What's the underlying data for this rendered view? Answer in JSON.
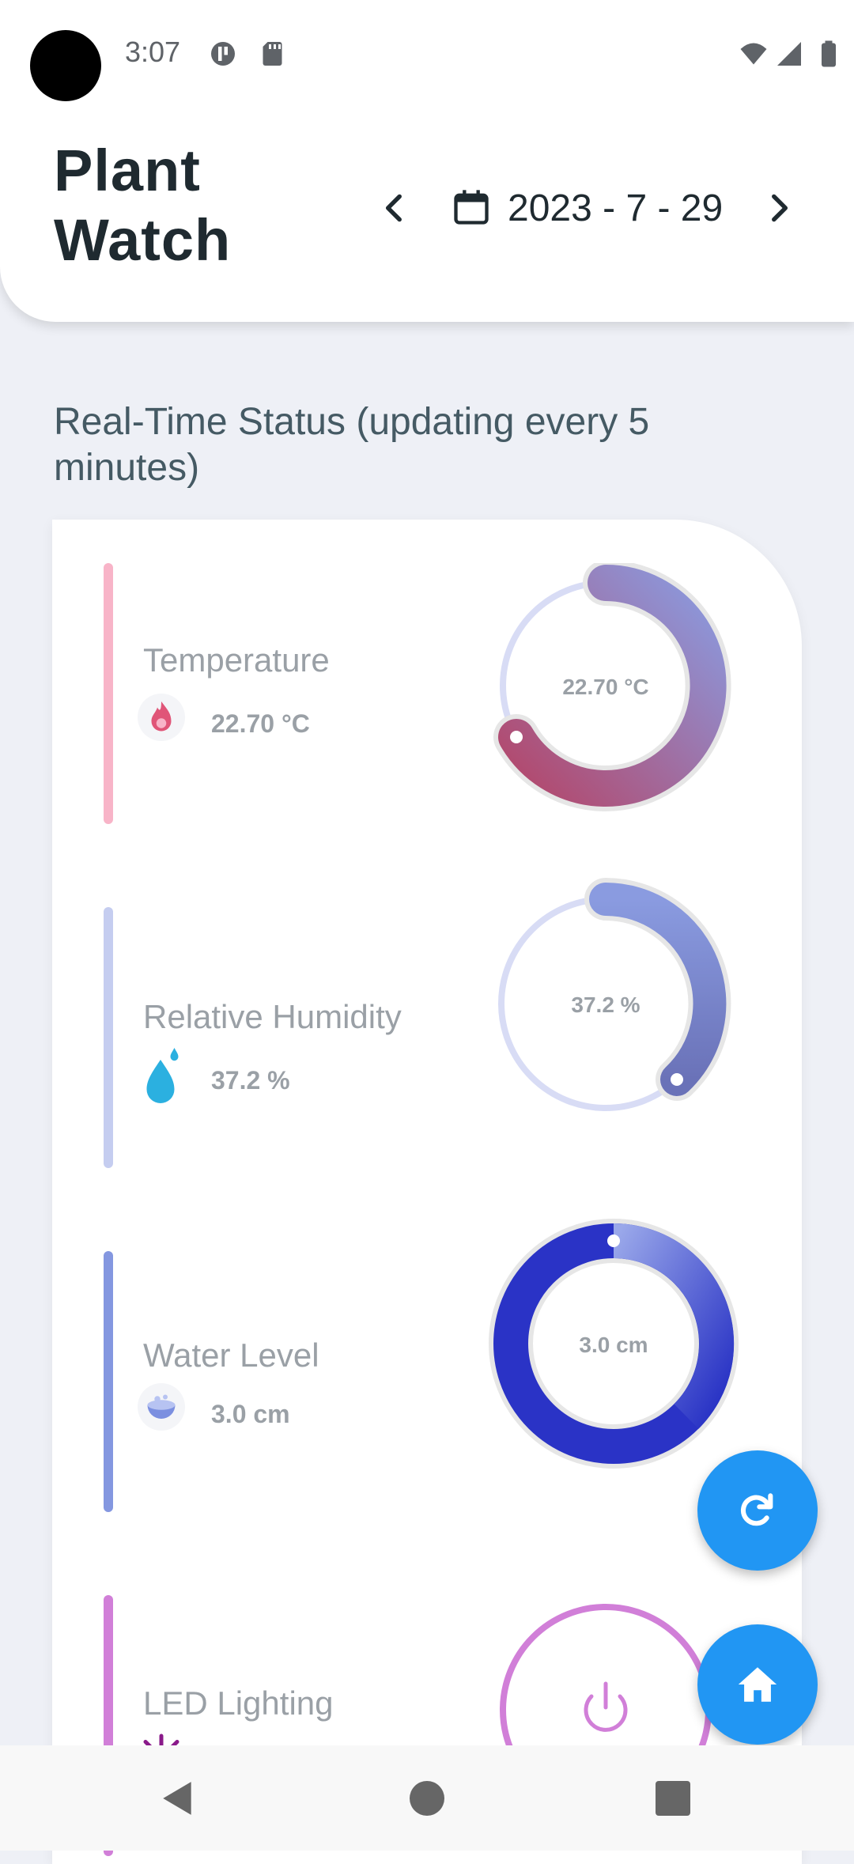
{
  "status_bar": {
    "time": "3:07"
  },
  "header": {
    "title": "Plant Watch",
    "date": "2023 - 7 - 29"
  },
  "section": {
    "title": "Real-Time Status (updating every 5 minutes)"
  },
  "metrics": [
    {
      "label": "Temperature",
      "value": "22.70 °C",
      "gauge_text": "22.70 °C",
      "accent": "#f8b4c8",
      "icon": "flame-icon"
    },
    {
      "label": "Relative Humidity",
      "value": "37.2 %",
      "gauge_text": "37.2 %",
      "accent": "#c5cdf0",
      "icon": "water-drop-icon"
    },
    {
      "label": "Water Level",
      "value": "3.0 cm",
      "gauge_text": "3.0 cm",
      "accent": "#8497e0",
      "icon": "water-bowl-icon"
    },
    {
      "label": "LED Lighting",
      "accent": "#d17fd8",
      "icon": "light-icon"
    }
  ],
  "fabs": {
    "refresh": "refresh-icon",
    "home": "home-icon"
  },
  "colors": {
    "fab": "#2196f3",
    "background": "#eef0f6"
  }
}
